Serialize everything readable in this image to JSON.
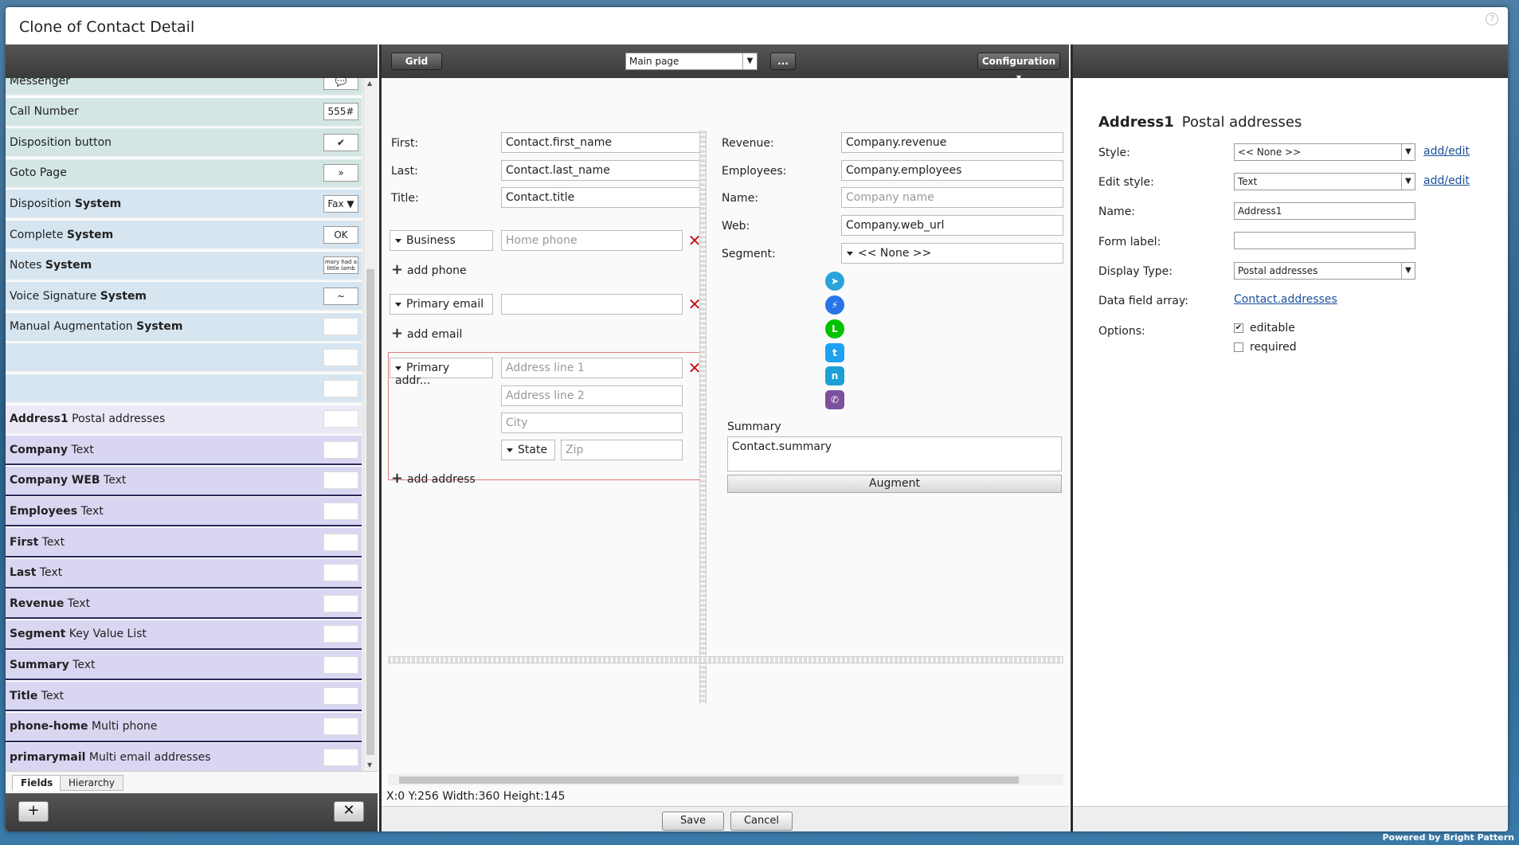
{
  "window": {
    "title": "Clone of Contact Detail",
    "help_icon": "question-icon"
  },
  "fields": {
    "items": [
      {
        "name": "Messenger",
        "type": "",
        "chip": "💬",
        "style": "green"
      },
      {
        "name": "Call Number",
        "type": "",
        "chip": "555#",
        "style": "green"
      },
      {
        "name": "Disposition button",
        "type": "",
        "chip": "✔",
        "style": "green"
      },
      {
        "name": "Goto Page",
        "type": "",
        "chip": "»",
        "style": "green"
      },
      {
        "name": "Disposition ",
        "type": "System",
        "chip": "Fax ▼",
        "style": "sys"
      },
      {
        "name": "Complete ",
        "type": "System",
        "chip": "OK",
        "style": "sys"
      },
      {
        "name": "Notes ",
        "type": "System",
        "chip": "mary had a little lamb",
        "style": "sys"
      },
      {
        "name": "Voice Signature ",
        "type": "System",
        "chip": "~",
        "style": "sys"
      },
      {
        "name": "Manual Augmentation ",
        "type": "System",
        "chip": "",
        "style": "sys"
      },
      {
        "name": "",
        "type": "",
        "chip": "",
        "style": "sys"
      },
      {
        "name": "",
        "type": "",
        "chip": "",
        "style": "sys"
      },
      {
        "name": "Address1",
        "type": " Postal addresses",
        "chip": "",
        "style": "sel"
      },
      {
        "name": "Company",
        "type": " Text",
        "chip": "",
        "style": "purple"
      },
      {
        "name": "Company WEB",
        "type": " Text",
        "chip": "",
        "style": "purple"
      },
      {
        "name": "Employees",
        "type": " Text",
        "chip": "",
        "style": "purple"
      },
      {
        "name": "First",
        "type": " Text",
        "chip": "",
        "style": "purple"
      },
      {
        "name": "Last",
        "type": " Text",
        "chip": "",
        "style": "purple"
      },
      {
        "name": "Revenue",
        "type": " Text",
        "chip": "",
        "style": "purple"
      },
      {
        "name": "Segment",
        "type": " Key Value List",
        "chip": "",
        "style": "purple"
      },
      {
        "name": "Summary",
        "type": " Text",
        "chip": "",
        "style": "purple"
      },
      {
        "name": "Title",
        "type": " Text",
        "chip": "",
        "style": "purple"
      },
      {
        "name": "phone-home",
        "type": " Multi phone",
        "chip": "",
        "style": "purple"
      },
      {
        "name": "primarymail",
        "type": " Multi email addresses",
        "chip": "",
        "style": "purple"
      }
    ],
    "tabs": [
      "Fields",
      "Hierarchy"
    ],
    "add_label": "+",
    "delete_label": "✕"
  },
  "toolbar": {
    "grid_label": "Grid ...",
    "page_select": "Main page",
    "more_label": "...",
    "config_label": "Configuration ▾"
  },
  "form": {
    "first_label": "First:",
    "first_value": "Contact.first_name",
    "last_label": "Last:",
    "last_value": "Contact.last_name",
    "title_label": "Title:",
    "title_value": "Contact.title",
    "phone_type": "Business",
    "phone_placeholder": "Home phone",
    "add_phone": "add phone",
    "email_type": "Primary email",
    "email_value": "",
    "add_email": "add email",
    "address_type": "Primary addr...",
    "addr1": "Address line 1",
    "addr2": "Address line 2",
    "city": "City",
    "state": "State",
    "zip": "Zip",
    "add_address": "add address",
    "revenue_label": "Revenue:",
    "revenue_value": "Company.revenue",
    "employees_label": "Employees:",
    "employees_value": "Company.employees",
    "name_label": "Name:",
    "name_placeholder": "Company name",
    "web_label": "Web:",
    "web_value": "Company.web_url",
    "segment_label": "Segment:",
    "segment_value": "<< None >>",
    "summary_label": "Summary",
    "summary_value": "Contact.summary",
    "augment_label": "Augment",
    "social_icons": [
      "telegram-icon",
      "messenger-icon",
      "line-icon",
      "twitter-icon",
      "nextdoor-icon",
      "viber-icon"
    ]
  },
  "status": {
    "coords": "X:0 Y:256 Width:360 Height:145"
  },
  "footer": {
    "save_label": "Save",
    "cancel_label": "Cancel"
  },
  "properties": {
    "field_name": "Address1",
    "field_type": "Postal addresses",
    "style_label": "Style:",
    "style_value": "<< None >>",
    "style_link": "add/edit",
    "edit_style_label": "Edit style:",
    "edit_style_value": "Text",
    "edit_style_link": "add/edit",
    "name_label": "Name:",
    "name_value": "Address1",
    "form_label_label": "Form label:",
    "form_label_value": "",
    "display_type_label": "Display Type:",
    "display_type_value": "Postal addresses",
    "data_field_label": "Data field array:",
    "data_field_value": "Contact.addresses",
    "options_label": "Options:",
    "opt_editable": "editable",
    "opt_required": "required"
  },
  "powered_by": "Powered by Bright Pattern"
}
